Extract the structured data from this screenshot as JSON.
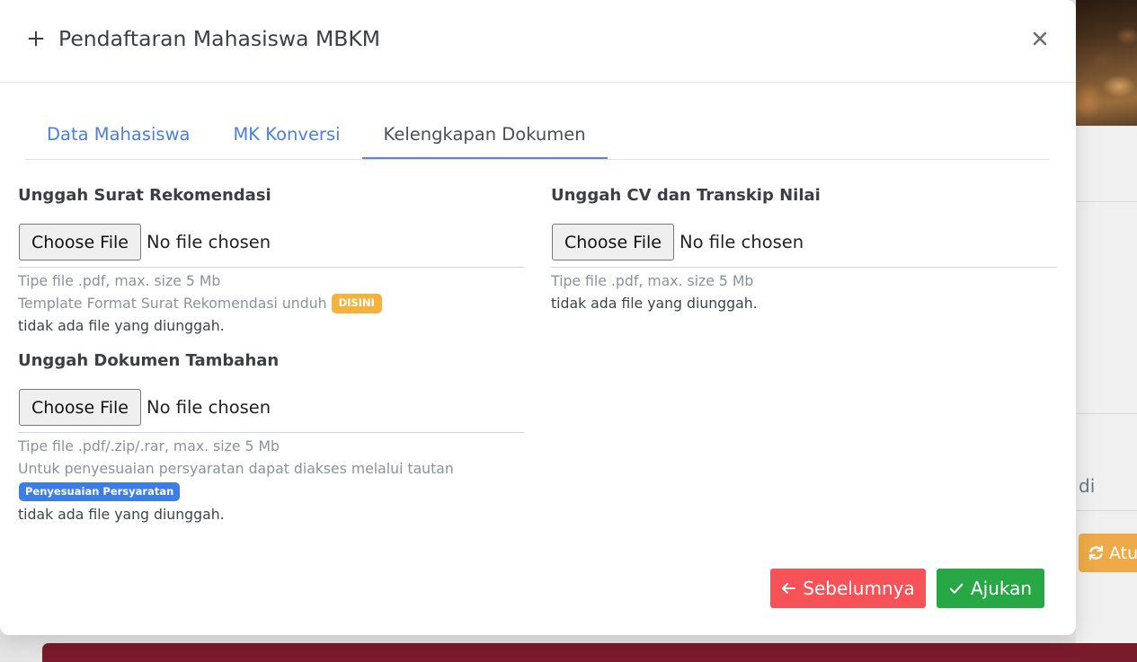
{
  "modal": {
    "title": "Pendaftaran Mahasiswa MBKM",
    "title_icon": "plus-icon",
    "close_icon": "close-icon"
  },
  "tabs": [
    {
      "label": "Data Mahasiswa",
      "active": false
    },
    {
      "label": "MK Konversi",
      "active": false
    },
    {
      "label": "Kelengkapan Dokumen",
      "active": true
    }
  ],
  "uploads": {
    "surat_rekomendasi": {
      "heading": "Unggah Surat Rekomendasi",
      "choose_label": "Choose File",
      "file_status": "No file chosen",
      "hint": "Tipe file .pdf, max. size 5 Mb",
      "template_text": "Template Format Surat Rekomendasi unduh",
      "template_badge": "DISINI",
      "uploaded_status": "tidak ada file yang diunggah."
    },
    "dokumen_tambahan": {
      "heading": "Unggah Dokumen Tambahan",
      "choose_label": "Choose File",
      "file_status": "No file chosen",
      "hint": "Tipe file .pdf/.zip/.rar, max. size 5 Mb",
      "info_text": "Untuk penyesuaian persyaratan dapat diakses melalui tautan",
      "info_badge": "Penyesuaian Persyaratan",
      "uploaded_status": "tidak ada file yang diunggah."
    },
    "cv_transkip": {
      "heading": "Unggah CV dan Transkip Nilai",
      "choose_label": "Choose File",
      "file_status": "No file chosen",
      "hint": "Tipe file .pdf, max. size 5 Mb",
      "uploaded_status": "tidak ada file yang diunggah."
    }
  },
  "footer": {
    "prev_button": {
      "label": "Sebelumnya",
      "icon": "arrow-left-icon"
    },
    "submit_button": {
      "label": "Ajukan",
      "icon": "check-icon"
    }
  },
  "background_page": {
    "partial_text": "di",
    "refresh_button": {
      "label": "Atu",
      "icon": "refresh-icon"
    }
  },
  "colors": {
    "tab_link": "#4a7fe2",
    "tab_active_text": "#4a4f55",
    "tab_active_underline": "#4d84f0",
    "badge_orange": "#f7b23d",
    "badge_blue": "#3d7de8",
    "prev_button": "#f65257",
    "submit_button": "#28a745",
    "refresh_button": "#eeaa48",
    "footer_bar": "#7a1b2c"
  }
}
